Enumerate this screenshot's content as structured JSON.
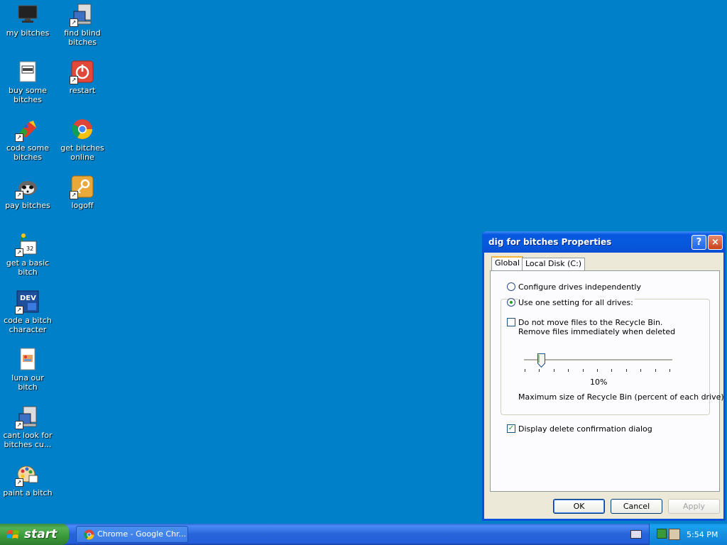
{
  "desktop": {
    "icons": [
      {
        "label": "my bitches"
      },
      {
        "label": "find blind bitches"
      },
      {
        "label": "buy some bitches"
      },
      {
        "label": "restart"
      },
      {
        "label": "code some bitches"
      },
      {
        "label": "get bitches online"
      },
      {
        "label": "pay bitches"
      },
      {
        "label": "logoff"
      },
      {
        "label": "get a basic bitch"
      },
      {
        "label": "code a bitch character"
      },
      {
        "label": "luna our bitch"
      },
      {
        "label": "cant look for bitches cu..."
      },
      {
        "label": "paint a bitch"
      }
    ],
    "background_color": "#0080c8"
  },
  "dialog": {
    "title": "dig for bitches Properties",
    "help_icon": "?",
    "close_icon": "×",
    "tabs": [
      {
        "label": "Global",
        "active": true
      },
      {
        "label": "Local Disk (C:)",
        "active": false
      }
    ],
    "options": {
      "configure_independently": "Configure drives independently",
      "use_one_setting": "Use one setting for all drives:",
      "selected": "use_one_setting"
    },
    "do_not_move": {
      "line1": "Do not move files to the Recycle Bin.",
      "line2": "Remove files immediately when deleted",
      "checked": false
    },
    "slider": {
      "value_label": "10%",
      "value": 10,
      "description": "Maximum size of Recycle Bin (percent of each drive)"
    },
    "confirm_dialog": {
      "label": "Display delete confirmation dialog",
      "checked": true
    },
    "buttons": {
      "ok": "OK",
      "cancel": "Cancel",
      "apply": "Apply"
    }
  },
  "taskbar": {
    "start_label": "start",
    "task_label": "Chrome - Google Chr...",
    "clock": "5:54 PM"
  }
}
